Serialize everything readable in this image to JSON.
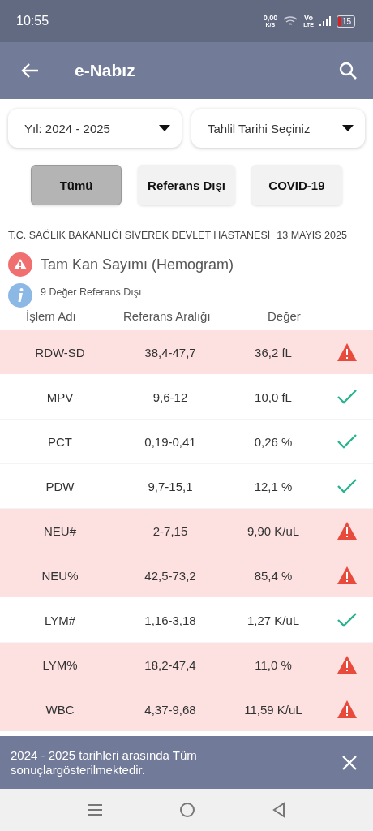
{
  "status_bar": {
    "time": "10:55",
    "speed": "0,00",
    "speed_unit": "K/S",
    "volte_top": "Vo",
    "volte_bottom": "LTE",
    "battery": "15"
  },
  "app_bar": {
    "title": "e-Nabız"
  },
  "dropdowns": [
    {
      "value": "Yıl: 2024 - 2025"
    },
    {
      "value": "Tahlil Tarihi Seçiniz"
    }
  ],
  "filters": [
    {
      "label": "Tümü",
      "selected": true
    },
    {
      "label": "Referans Dışı",
      "selected": false
    },
    {
      "label": "COVID-19",
      "selected": false
    }
  ],
  "hospital": "T.C. SAĞLIK BAKANLIĞI SİVEREK DEVLET HASTANESİ",
  "date": "13 MAYIS 2025",
  "test": {
    "title": "Tam Kan Sayımı (Hemogram)",
    "out_of_range_count": "9 Değer Referans Dışı"
  },
  "table": {
    "columns": [
      "İşlem Adı",
      "Referans Aralığı",
      "Değer"
    ],
    "rows": [
      {
        "name": "RDW-SD",
        "range": "38,4-47,7",
        "value": "36,2 fL",
        "out_of_range": true
      },
      {
        "name": "MPV",
        "range": "9,6-12",
        "value": "10,0 fL",
        "out_of_range": false
      },
      {
        "name": "PCT",
        "range": "0,19-0,41",
        "value": "0,26 %",
        "out_of_range": false
      },
      {
        "name": "PDW",
        "range": "9,7-15,1",
        "value": "12,1 %",
        "out_of_range": false
      },
      {
        "name": "NEU#",
        "range": "2-7,15",
        "value": "9,90 K/uL",
        "out_of_range": true
      },
      {
        "name": "NEU%",
        "range": "42,5-73,2",
        "value": "85,4 %",
        "out_of_range": true
      },
      {
        "name": "LYM#",
        "range": "1,16-3,18",
        "value": "1,27 K/uL",
        "out_of_range": false
      },
      {
        "name": "LYM%",
        "range": "18,2-47,4",
        "value": "11,0 %",
        "out_of_range": true
      },
      {
        "name": "WBC",
        "range": "4,37-9,68",
        "value": "11,59 K/uL",
        "out_of_range": true
      }
    ]
  },
  "snackbar": {
    "message": "2024 - 2025 tarihleri arasında Tüm sonuçlargösterilmektedir."
  }
}
